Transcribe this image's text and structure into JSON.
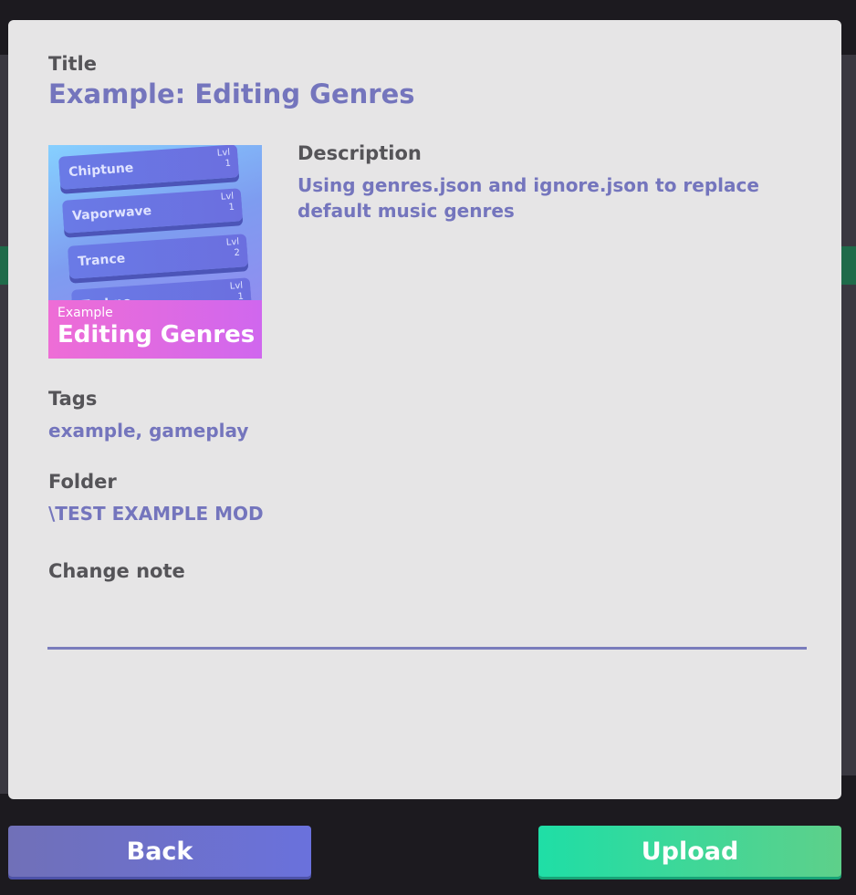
{
  "form": {
    "title_label": "Title",
    "title_value": "Example: Editing Genres",
    "description_label": "Description",
    "description_value": "Using genres.json and ignore.json to replace default music genres",
    "tags_label": "Tags",
    "tags_value": "example, gameplay",
    "folder_label": "Folder",
    "folder_value": "\\TEST EXAMPLE MOD",
    "change_note_label": "Change note",
    "change_note_value": ""
  },
  "thumbnail": {
    "tiles": [
      {
        "name": "Chiptune",
        "lvl_label": "Lvl",
        "lvl": "1"
      },
      {
        "name": "Vaporwave",
        "lvl_label": "Lvl",
        "lvl": "1"
      },
      {
        "name": "Trance",
        "lvl_label": "Lvl",
        "lvl": "2"
      },
      {
        "name": "Techno",
        "lvl_label": "Lvl",
        "lvl": "1"
      }
    ],
    "caption_small": "Example",
    "caption_big": "Editing Genres"
  },
  "buttons": {
    "back_label": "Back",
    "upload_label": "Upload"
  },
  "colors": {
    "accent": "#7475bd",
    "label": "#555458",
    "upload": "#1fdea6",
    "back": "#6a71dc"
  }
}
